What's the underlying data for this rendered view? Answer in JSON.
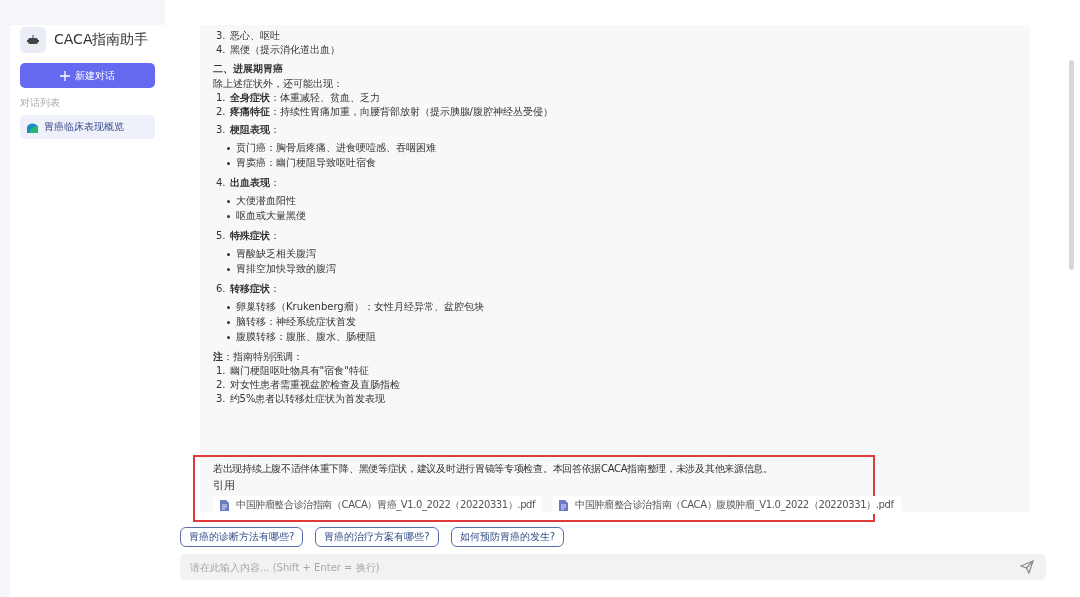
{
  "sidebar": {
    "title": "CACA指南助手",
    "new_chat_button": "新建对话",
    "section_label": "对话列表",
    "conversations": [
      {
        "title": "胃癌临床表现概览",
        "selected": true
      }
    ]
  },
  "message": {
    "blocks": [
      {
        "kind": "numbered",
        "number": "3.",
        "text": "恶心、呕吐"
      },
      {
        "kind": "numbered",
        "number": "4.",
        "text": "黑便（提示消化道出血）"
      },
      {
        "kind": "heading",
        "text": "二、进展期胃癌"
      },
      {
        "kind": "paragraph",
        "text": "除上述症状外，还可能出现："
      },
      {
        "kind": "numbered",
        "number": "1.",
        "text": "**全身症状**：体重减轻、贫血、乏力"
      },
      {
        "kind": "numbered",
        "number": "2.",
        "text": "**疼痛特征**：持续性胃痛加重，向腰背部放射（提示胰腺/腹腔神经丛受侵）"
      },
      {
        "kind": "numbered",
        "number": "3.",
        "text": "**梗阻表现**：",
        "children": [
          "贲门癌：胸骨后疼痛、进食哽噎感、吞咽困难",
          "胃窦癌：幽门梗阻导致呕吐宿食"
        ]
      },
      {
        "kind": "numbered",
        "number": "4.",
        "text": "**出血表现**：",
        "children": [
          "大便潜血阳性",
          "呕血或大量黑便"
        ]
      },
      {
        "kind": "numbered",
        "number": "5.",
        "text": "**特殊症状**：",
        "children": [
          "胃酸缺乏相关腹泻",
          "胃排空加快导致的腹泻"
        ]
      },
      {
        "kind": "numbered",
        "number": "6.",
        "text": "**转移症状**：",
        "children": [
          "卵巢转移（Krukenberg瘤）：女性月经异常、盆腔包块",
          "脑转移：神经系统症状首发",
          "腹膜转移：腹胀、腹水、肠梗阻"
        ]
      },
      {
        "kind": "paragraph",
        "text": "**注**：指南特别强调："
      },
      {
        "kind": "numbered",
        "number": "1.",
        "text": "幽门梗阻呕吐物具有\"宿食\"特征"
      },
      {
        "kind": "numbered",
        "number": "2.",
        "text": "对女性患者需重视盆腔检查及直肠指检"
      },
      {
        "kind": "numbered",
        "number": "3.",
        "text": "约5%患者以转移灶症状为首发表现"
      }
    ],
    "disclaimer": "若出现持续上腹不适伴体重下降、黑便等症状，建议及时进行胃镜等专项检查。本回答依据CACA指南整理，未涉及其他来源信息。",
    "citations_label": "引用",
    "citations": [
      "中国肿瘤整合诊治指南（CACA）胃癌_V1.0_2022（20220331）.pdf",
      "中国肿瘤整合诊治指南（CACA）腹膜肿瘤_V1.0_2022（20220331）.pdf"
    ]
  },
  "suggestions": [
    "胃癌的诊断方法有哪些?",
    "胃癌的治疗方案有哪些?",
    "如何预防胃癌的发生?"
  ],
  "input": {
    "placeholder": "请在此输入内容... (Shift + Enter = 换行)"
  }
}
